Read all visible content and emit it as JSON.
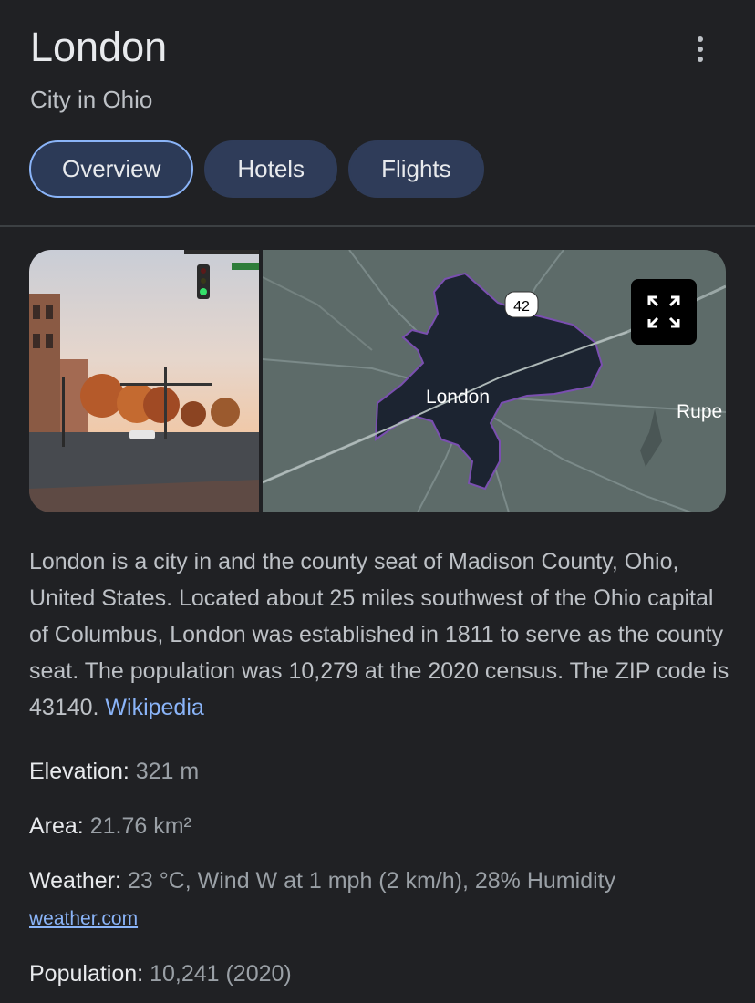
{
  "header": {
    "title": "London",
    "subtitle": "City in Ohio",
    "more_icon": "more-vert-icon"
  },
  "tabs": [
    {
      "label": "Overview",
      "active": true
    },
    {
      "label": "Hotels",
      "active": false
    },
    {
      "label": "Flights",
      "active": false
    }
  ],
  "map": {
    "city_label": "London",
    "route_label": "42",
    "neighbor_label": "Rupe",
    "expand_icon": "fullscreen-icon"
  },
  "description": {
    "text": "London is a city in and the county seat of Madison County, Ohio, United States. Located about 25 miles southwest of the Ohio capital of Columbus, London was established in 1811 to serve as the county seat. The population was 10,279 at the 2020 census. The ZIP code is 43140.",
    "source_link": "Wikipedia"
  },
  "facts": {
    "elevation": {
      "label": "Elevation:",
      "value": "321 m"
    },
    "area": {
      "label": "Area:",
      "value": "21.76 km²"
    },
    "weather": {
      "label": "Weather:",
      "value": "23 °C, Wind W at 1 mph (2 km/h), 28% Humidity",
      "source": "weather.com"
    },
    "population": {
      "label": "Population:",
      "value": "10,241 (2020)"
    }
  },
  "colors": {
    "background": "#202124",
    "accent": "#8ab4f8",
    "tab_bg": "#2f3c59"
  }
}
